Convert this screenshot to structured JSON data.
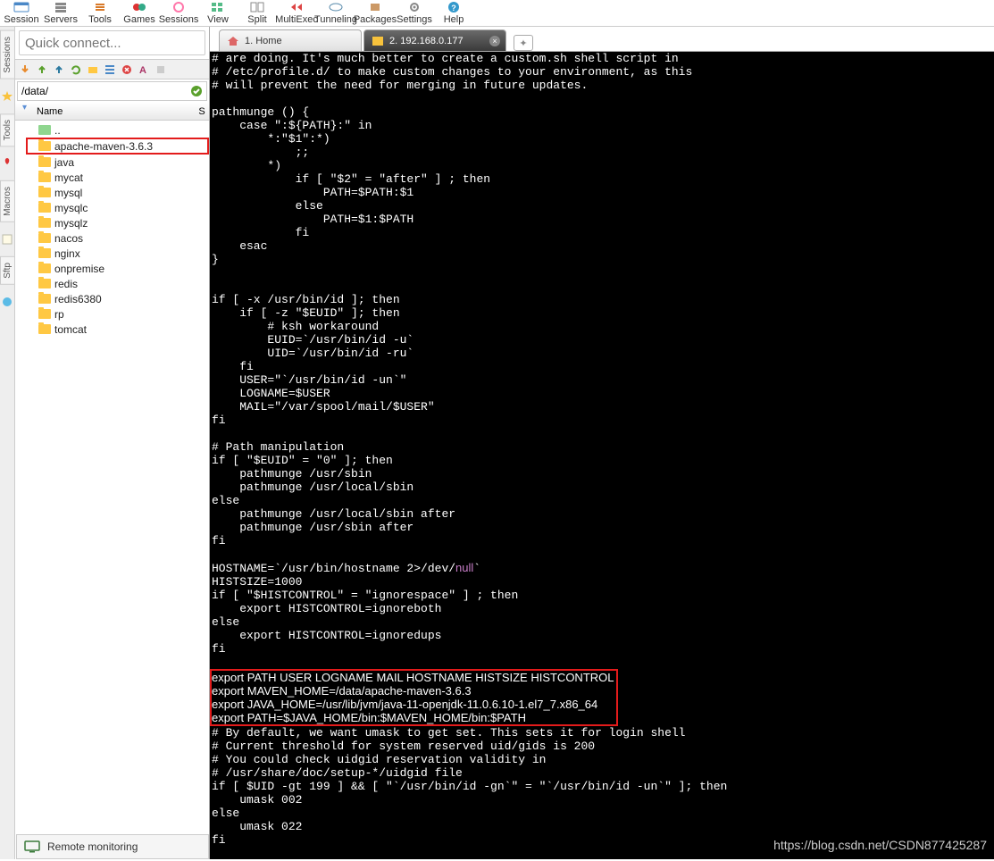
{
  "toolbar": [
    "Session",
    "Servers",
    "Tools",
    "Games",
    "Sessions",
    "View",
    "Split",
    "MultiExec",
    "Tunneling",
    "Packages",
    "Settings",
    "Help"
  ],
  "quick_connect_placeholder": "Quick connect...",
  "path": "/data/",
  "tree_header": {
    "name": "Name",
    "s": "S"
  },
  "tree": [
    {
      "label": "..",
      "up": true
    },
    {
      "label": "apache-maven-3.6.3",
      "highlighted": true
    },
    {
      "label": "java"
    },
    {
      "label": "mycat"
    },
    {
      "label": "mysql"
    },
    {
      "label": "mysqlc"
    },
    {
      "label": "mysqlz"
    },
    {
      "label": "nacos"
    },
    {
      "label": "nginx"
    },
    {
      "label": "onpremise"
    },
    {
      "label": "redis"
    },
    {
      "label": "redis6380"
    },
    {
      "label": "rp"
    },
    {
      "label": "tomcat"
    }
  ],
  "tabs": [
    {
      "label": "1. Home",
      "active": false,
      "icon": "home"
    },
    {
      "label": "2. 192.168.0.177",
      "active": true,
      "icon": "wrench"
    }
  ],
  "rail": [
    "Sessions",
    "Tools",
    "Macros",
    "Sftp"
  ],
  "terminal_lines": [
    "# are doing. It's much better to create a custom.sh shell script in",
    "# /etc/profile.d/ to make custom changes to your environment, as this",
    "# will prevent the need for merging in future updates.",
    "",
    "pathmunge () {",
    "    case \":${PATH}:\" in",
    "        *:\"$1\":*)",
    "            ;;",
    "        *)",
    "            if [ \"$2\" = \"after\" ] ; then",
    "                PATH=$PATH:$1",
    "            else",
    "                PATH=$1:$PATH",
    "            fi",
    "    esac",
    "}",
    "",
    "",
    "if [ -x /usr/bin/id ]; then",
    "    if [ -z \"$EUID\" ]; then",
    "        # ksh workaround",
    "        EUID=`/usr/bin/id -u`",
    "        UID=`/usr/bin/id -ru`",
    "    fi",
    "    USER=\"`/usr/bin/id -un`\"",
    "    LOGNAME=$USER",
    "    MAIL=\"/var/spool/mail/$USER\"",
    "fi",
    "",
    "# Path manipulation",
    "if [ \"$EUID\" = \"0\" ]; then",
    "    pathmunge /usr/sbin",
    "    pathmunge /usr/local/sbin",
    "else",
    "    pathmunge /usr/local/sbin after",
    "    pathmunge /usr/sbin after",
    "fi",
    ""
  ],
  "terminal_hostname_pre": "HOSTNAME=`/usr/bin/hostname 2>/dev/",
  "terminal_hostname_null": "null",
  "terminal_hostname_post": "`",
  "terminal_lines2": [
    "HISTSIZE=1000",
    "if [ \"$HISTCONTROL\" = \"ignorespace\" ] ; then",
    "    export HISTCONTROL=ignoreboth",
    "else",
    "    export HISTCONTROL=ignoredups",
    "fi",
    ""
  ],
  "terminal_box": [
    "export PATH USER LOGNAME MAIL HOSTNAME HISTSIZE HISTCONTROL",
    "export MAVEN_HOME=/data/apache-maven-3.6.3",
    "export JAVA_HOME=/usr/lib/jvm/java-11-openjdk-11.0.6.10-1.el7_7.x86_64",
    "export PATH=$JAVA_HOME/bin:$MAVEN_HOME/bin:$PATH"
  ],
  "terminal_lines3": [
    "",
    "# By default, we want umask to get set. This sets it for login shell",
    "# Current threshold for system reserved uid/gids is 200",
    "# You could check uidgid reservation validity in",
    "# /usr/share/doc/setup-*/uidgid file",
    "if [ $UID -gt 199 ] && [ \"`/usr/bin/id -gn`\" = \"`/usr/bin/id -un`\" ]; then",
    "    umask 002",
    "else",
    "    umask 022",
    "fi"
  ],
  "status": "Remote monitoring",
  "watermark": "https://blog.csdn.net/CSDN877425287"
}
